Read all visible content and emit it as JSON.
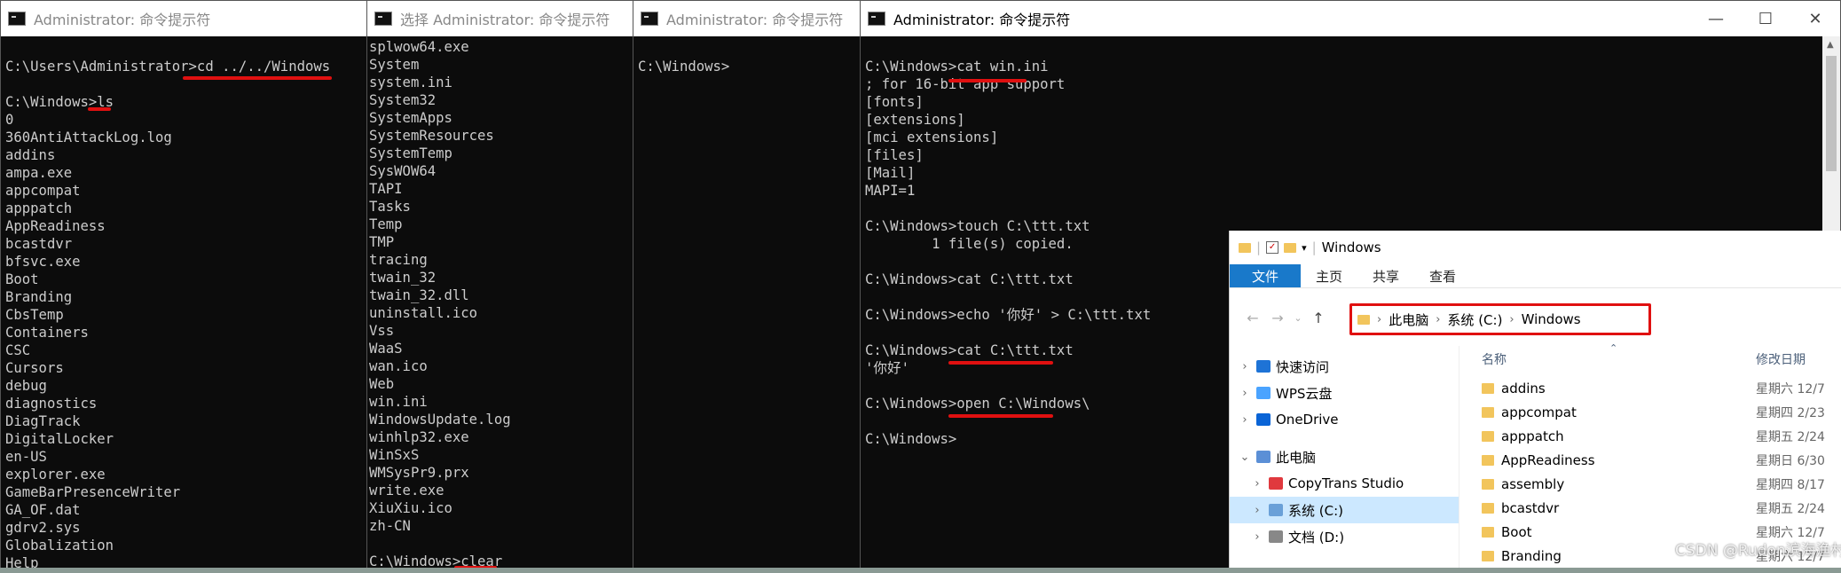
{
  "windows": [
    {
      "title": "Administrator: 命令提示符",
      "active": false,
      "lines": [
        "",
        "C:\\Users\\Administrator>cd ../../Windows",
        "",
        "C:\\Windows>ls",
        "0",
        "360AntiAttackLog.log",
        "addins",
        "ampa.exe",
        "appcompat",
        "apppatch",
        "AppReadiness",
        "bcastdvr",
        "bfsvc.exe",
        "Boot",
        "Branding",
        "CbsTemp",
        "Containers",
        "CSC",
        "Cursors",
        "debug",
        "diagnostics",
        "DiagTrack",
        "DigitalLocker",
        "en-US",
        "explorer.exe",
        "GameBarPresenceWriter",
        "GA_OF.dat",
        "gdrv2.sys",
        "Globalization",
        "Help"
      ]
    },
    {
      "title": "选择 Administrator: 命令提示符",
      "active": false,
      "lines": [
        "splwow64.exe",
        "System",
        "system.ini",
        "System32",
        "SystemApps",
        "SystemResources",
        "SystemTemp",
        "SysWOW64",
        "TAPI",
        "Tasks",
        "Temp",
        "TMP",
        "tracing",
        "twain_32",
        "twain_32.dll",
        "uninstall.ico",
        "Vss",
        "WaaS",
        "wan.ico",
        "Web",
        "win.ini",
        "WindowsUpdate.log",
        "winhlp32.exe",
        "WinSxS",
        "WMSysPr9.prx",
        "write.exe",
        "XiuXiu.ico",
        "zh-CN",
        "",
        "C:\\Windows>clear"
      ]
    },
    {
      "title": "Administrator: 命令提示符",
      "active": false,
      "lines": [
        "",
        "C:\\Windows>"
      ]
    },
    {
      "title": "Administrator: 命令提示符",
      "active": true,
      "controls": [
        "—",
        "☐",
        "✕"
      ],
      "lines": [
        "",
        "C:\\Windows>cat win.ini",
        "; for 16-bit app support",
        "[fonts]",
        "[extensions]",
        "[mci extensions]",
        "[files]",
        "[Mail]",
        "MAPI=1",
        "",
        "C:\\Windows>touch C:\\ttt.txt",
        "        1 file(s) copied.",
        "",
        "C:\\Windows>cat C:\\ttt.txt",
        "",
        "C:\\Windows>echo '你好' > C:\\ttt.txt",
        "",
        "C:\\Windows>cat C:\\ttt.txt",
        "'你好'",
        "",
        "C:\\Windows>open C:\\Windows\\",
        "",
        "C:\\Windows>"
      ]
    }
  ],
  "explorer": {
    "title": "Windows",
    "ribbon_tabs": [
      "文件",
      "主页",
      "共享",
      "查看"
    ],
    "breadcrumb": [
      "此电脑",
      "系统 (C:)",
      "Windows"
    ],
    "col_name": "名称",
    "col_date": "修改日期",
    "nav_items": [
      {
        "label": "快速访问",
        "icon_color": "#1e73d6",
        "expander": "›",
        "indent": 0
      },
      {
        "label": "WPS云盘",
        "icon_color": "#4aa3ff",
        "expander": "›",
        "indent": 0
      },
      {
        "label": "OneDrive",
        "icon_color": "#0a64d6",
        "expander": "›",
        "indent": 0
      },
      {
        "label": "此电脑",
        "icon_color": "#5b8fd6",
        "expander": "⌄",
        "indent": 0
      },
      {
        "label": "CopyTrans Studio",
        "icon_color": "#e0393e",
        "expander": "›",
        "indent": 1
      },
      {
        "label": "系统 (C:)",
        "icon_color": "#6aa0d8",
        "expander": "›",
        "indent": 1,
        "selected": true
      },
      {
        "label": "文档 (D:)",
        "icon_color": "#888888",
        "expander": "›",
        "indent": 1
      }
    ],
    "files": [
      {
        "name": "addins",
        "date": "星期六 12/7"
      },
      {
        "name": "appcompat",
        "date": "星期四 2/23"
      },
      {
        "name": "apppatch",
        "date": "星期五 2/24"
      },
      {
        "name": "AppReadiness",
        "date": "星期日 6/30"
      },
      {
        "name": "assembly",
        "date": "星期四 8/17"
      },
      {
        "name": "bcastdvr",
        "date": "星期五 2/24"
      },
      {
        "name": "Boot",
        "date": "星期六 12/7"
      },
      {
        "name": "Branding",
        "date": "星期六 12/7"
      }
    ]
  },
  "watermark": "CSDN @Rudon滨海渔村"
}
